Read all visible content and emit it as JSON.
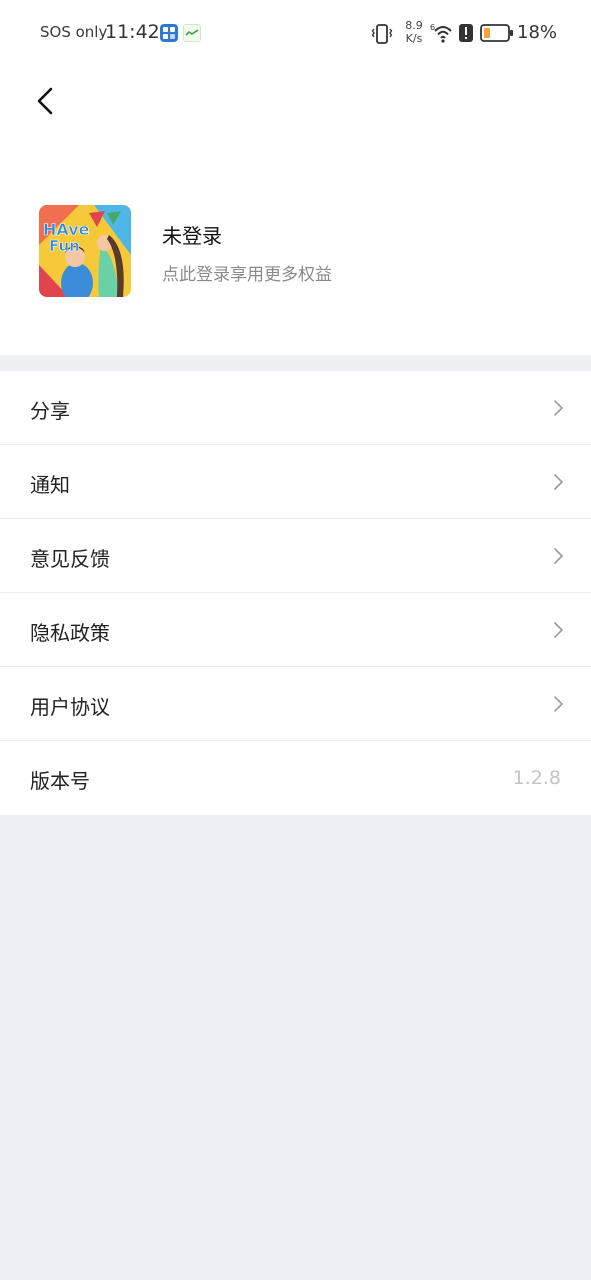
{
  "status_bar": {
    "carrier": "SOS only",
    "time": "11:42",
    "net_speed_value": "8.9",
    "net_speed_unit": "K/s",
    "battery_percent": "18%",
    "icons": [
      "app-notification-icon",
      "app-notification-icon-2",
      "vibrate-icon",
      "wifi-icon",
      "alert-icon",
      "battery-icon"
    ]
  },
  "header": {
    "back_icon": "chevron-left-icon"
  },
  "profile": {
    "avatar_text": "HAve Fun",
    "title": "未登录",
    "subtitle": "点此登录享用更多权益"
  },
  "settings": {
    "items": [
      {
        "label": "分享",
        "icon": "chevron-right-icon"
      },
      {
        "label": "通知",
        "icon": "chevron-right-icon"
      },
      {
        "label": "意见反馈",
        "icon": "chevron-right-icon"
      },
      {
        "label": "隐私政策",
        "icon": "chevron-right-icon"
      },
      {
        "label": "用户协议",
        "icon": "chevron-right-icon"
      }
    ],
    "version_label": "版本号",
    "version_value": "1.2.8"
  },
  "colors": {
    "background": "#eff0f4",
    "card": "#ffffff",
    "battery_low": "#f0a53a"
  }
}
